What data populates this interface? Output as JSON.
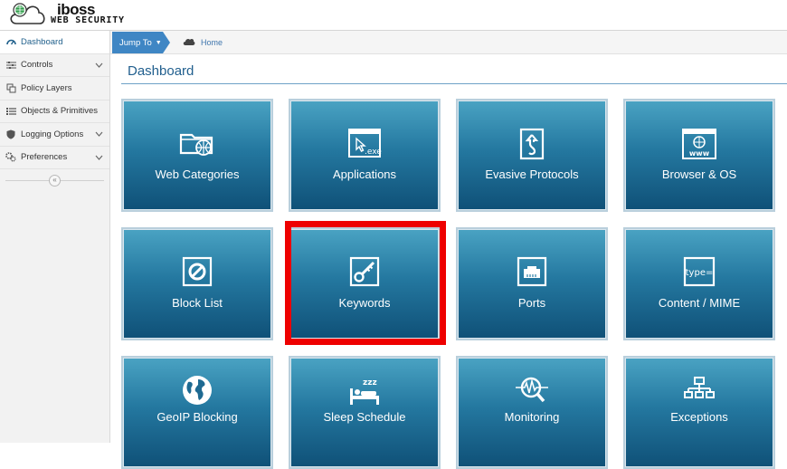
{
  "app": {
    "brand": "iboss",
    "sub": "WEB SECURITY"
  },
  "sidebar": {
    "items": [
      {
        "label": "Dashboard",
        "icon": "dashboard-icon",
        "active": true
      },
      {
        "label": "Controls",
        "icon": "sliders-icon",
        "has_chevron": true
      },
      {
        "label": "Policy Layers",
        "icon": "layers-icon"
      },
      {
        "label": "Objects & Primitives",
        "icon": "list-icon"
      },
      {
        "label": "Logging Options",
        "icon": "shield-icon",
        "has_chevron": true
      },
      {
        "label": "Preferences",
        "icon": "gears-icon",
        "has_chevron": true
      }
    ],
    "collapse_glyph": "«"
  },
  "breadcrumb": {
    "jump_to": "Jump To",
    "home": "Home"
  },
  "page_title": "Dashboard",
  "tiles": [
    {
      "label": "Web Categories",
      "icon": "folder-globe-icon"
    },
    {
      "label": "Applications",
      "icon": "exe-window-icon"
    },
    {
      "label": "Evasive Protocols",
      "icon": "evasive-arrow-icon"
    },
    {
      "label": "Browser & OS",
      "icon": "www-window-icon"
    },
    {
      "label": "Block List",
      "icon": "block-circle-icon"
    },
    {
      "label": "Keywords",
      "icon": "key-icon"
    },
    {
      "label": "Ports",
      "icon": "ethernet-port-icon"
    },
    {
      "label": "Content / MIME",
      "icon": "type-mime-icon",
      "icon_text": "type="
    },
    {
      "label": "GeoIP Blocking",
      "icon": "globe-icon"
    },
    {
      "label": "Sleep Schedule",
      "icon": "sleep-bed-icon"
    },
    {
      "label": "Monitoring",
      "icon": "monitoring-pulse-icon"
    },
    {
      "label": "Exceptions",
      "icon": "hierarchy-icon"
    }
  ],
  "colors": {
    "accent": "#3f86c4",
    "title": "#215f8e",
    "highlight": "#ee0000"
  }
}
